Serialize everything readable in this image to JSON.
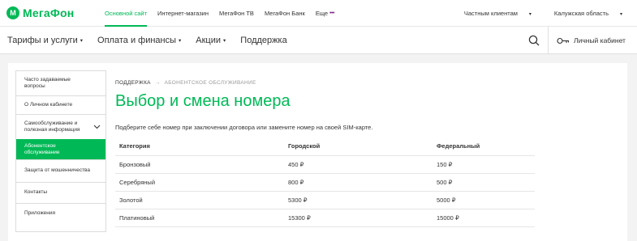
{
  "brand": {
    "mark": "М",
    "name": "МегаФон",
    "accent": "#00b956",
    "dots_color": "#731982"
  },
  "topbar": {
    "links": [
      {
        "label": "Основной сайт",
        "active": true
      },
      {
        "label": "Интернет-магазин"
      },
      {
        "label": "МегаФон ТВ"
      },
      {
        "label": "МегаФон Банк"
      },
      {
        "label": "Еще"
      }
    ],
    "more_dots": "•••",
    "clients": "Частным клиентам",
    "region": "Калужская область"
  },
  "nav": {
    "items": [
      "Тарифы и услуги",
      "Оплата и финансы",
      "Акции",
      "Поддержка"
    ],
    "search_icon": "search-icon",
    "account_label": "Личный кабинет",
    "account_icon": "key-icon"
  },
  "sidebar": {
    "items": [
      {
        "label": "Часто задаваемые вопросы"
      },
      {
        "label": "О Личном кабинете"
      },
      {
        "label": "Самообслуживание и полезная информация",
        "expandable": true
      },
      {
        "label": "Абонентское обслуживание",
        "active": true
      },
      {
        "label": "Защита от мошенничества"
      },
      {
        "label": "Контакты"
      },
      {
        "label": "Приложения"
      }
    ]
  },
  "breadcrumb": {
    "root": "ПОДДЕРЖКА",
    "separator": "→",
    "current": "АБОНЕНТСКОЕ ОБСЛУЖИВАНИЕ"
  },
  "page": {
    "title": "Выбор и смена номера",
    "lead": "Подберите себе номер при заключении договора или замените номер на своей SIM-карте."
  },
  "table": {
    "headers": [
      "Категория",
      "Городской",
      "Федеральный"
    ],
    "rows": [
      [
        "Бронзовый",
        "450 ₽",
        "150 ₽"
      ],
      [
        "Серебряный",
        "800 ₽",
        "500 ₽"
      ],
      [
        "Золотой",
        "5300 ₽",
        "5000 ₽"
      ],
      [
        "Платиновый",
        "15300 ₽",
        "15000 ₽"
      ]
    ]
  }
}
